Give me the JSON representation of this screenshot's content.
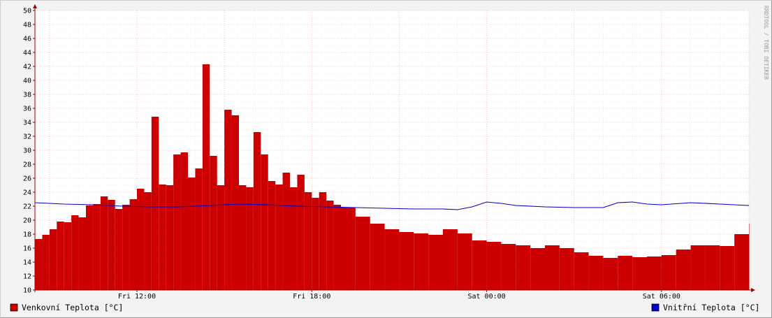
{
  "watermark": "RRDTOOL / TOBI OETIKER",
  "colors": {
    "outdoor": "#cc0000",
    "indoor": "#0000cc",
    "grid_major": "#ffb0b0",
    "grid_minor": "#e6e6e6",
    "axis": "#a00000",
    "plot_bg": "#ffffff"
  },
  "chart_data": {
    "type": "area",
    "ylim": [
      10,
      50
    ],
    "y_ticks": [
      "10",
      "12",
      "14",
      "16",
      "18",
      "20",
      "22",
      "24",
      "26",
      "28",
      "30",
      "32",
      "34",
      "36",
      "38",
      "40",
      "42",
      "44",
      "46",
      "48",
      "50"
    ],
    "x_ticks": [
      "Fri 12:00",
      "Fri 18:00",
      "Sat 00:00",
      "Sat 06:00"
    ],
    "x_tick_hours": [
      12,
      18,
      24,
      30
    ],
    "x_range_hours": [
      8.5,
      33.0
    ],
    "legend": "bottom",
    "series": [
      {
        "name": "Venkovní Teplota [°C]",
        "style": "area",
        "color": "#cc0000",
        "x_hours": [
          8.5,
          8.75,
          9.0,
          9.25,
          9.5,
          9.75,
          10.0,
          10.25,
          10.5,
          10.75,
          11.0,
          11.25,
          11.5,
          11.75,
          12.0,
          12.25,
          12.5,
          12.75,
          13.0,
          13.25,
          13.5,
          13.75,
          14.0,
          14.25,
          14.5,
          14.75,
          15.0,
          15.25,
          15.5,
          15.75,
          16.0,
          16.25,
          16.5,
          16.75,
          17.0,
          17.25,
          17.5,
          17.75,
          18.0,
          18.25,
          18.5,
          18.75,
          19.0,
          19.5,
          20.0,
          20.5,
          21.0,
          21.5,
          22.0,
          22.5,
          23.0,
          23.5,
          24.0,
          24.5,
          25.0,
          25.5,
          26.0,
          26.5,
          27.0,
          27.5,
          28.0,
          28.5,
          29.0,
          29.5,
          30.0,
          30.5,
          31.0,
          31.5,
          32.0,
          32.5,
          33.0
        ],
        "values": [
          17.3,
          17.9,
          18.7,
          19.8,
          19.7,
          20.7,
          20.4,
          22.1,
          22.3,
          23.4,
          22.9,
          21.6,
          22.2,
          23.0,
          24.5,
          24.0,
          34.8,
          25.1,
          25.0,
          29.4,
          29.7,
          26.1,
          27.4,
          42.3,
          29.2,
          25.0,
          35.8,
          35.0,
          25.0,
          24.7,
          32.6,
          29.4,
          25.6,
          25.1,
          26.8,
          24.7,
          26.5,
          24.0,
          23.2,
          24.0,
          22.8,
          22.2,
          21.8,
          20.5,
          19.5,
          18.7,
          18.3,
          18.1,
          17.9,
          18.7,
          18.1,
          17.1,
          16.9,
          16.6,
          16.4,
          16.0,
          16.4,
          16.0,
          15.4,
          14.9,
          14.6,
          14.9,
          14.7,
          14.8,
          15.0,
          15.8,
          16.4,
          16.4,
          16.3,
          18.0,
          19.5
        ]
      },
      {
        "name": "Vnitřní Teplota [°C]",
        "style": "line",
        "color": "#0000cc",
        "x_hours": [
          8.5,
          9.5,
          10.5,
          11.5,
          12.5,
          13.5,
          14.5,
          15.5,
          16.5,
          17.5,
          18.5,
          19.5,
          20.5,
          21.5,
          22.5,
          23.0,
          23.5,
          24.0,
          24.5,
          25.0,
          26.0,
          27.0,
          28.0,
          28.5,
          29.0,
          29.5,
          30.0,
          31.0,
          32.0,
          33.0
        ],
        "values": [
          22.5,
          22.3,
          22.2,
          22.0,
          21.9,
          21.9,
          22.1,
          22.3,
          22.2,
          22.0,
          21.9,
          21.8,
          21.7,
          21.6,
          21.6,
          21.5,
          21.9,
          22.6,
          22.4,
          22.1,
          21.9,
          21.8,
          21.8,
          22.5,
          22.6,
          22.3,
          22.2,
          22.5,
          22.3,
          22.1
        ]
      }
    ]
  }
}
